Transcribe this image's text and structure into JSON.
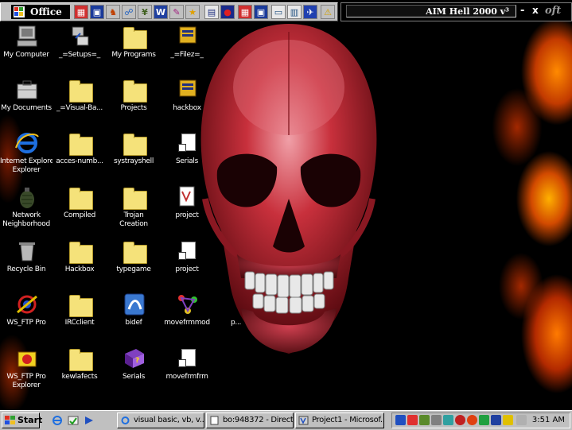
{
  "office_bar": {
    "title": "Office",
    "icons": [
      "office-app-icon-1",
      "office-app-icon-2",
      "office-app-icon-3",
      "office-app-icon-4",
      "office-app-icon-5",
      "office-app-icon-6",
      "office-app-icon-7",
      "office-app-icon-8",
      "office-app-icon-9",
      "office-app-icon-10",
      "office-app-icon-11",
      "office-app-icon-12",
      "office-app-icon-13",
      "office-app-icon-14",
      "office-app-icon-15",
      "office-app-icon-16"
    ]
  },
  "aim_bar": {
    "title": "AIM Hell 2000 v³",
    "minimize": "-",
    "close": "x",
    "brand": "oft"
  },
  "desktop_icons": [
    {
      "label": "My Computer",
      "icon": "computer-icon"
    },
    {
      "label": "My Documents",
      "icon": "briefcase-icon"
    },
    {
      "label": "Internet Explorer",
      "icon": "internet-explorer-icon",
      "label2": "Explorer"
    },
    {
      "label": "Network",
      "label2": "Neighborhood",
      "icon": "grenade-icon"
    },
    {
      "label": "Recycle Bin",
      "icon": "recycle-bin-icon"
    },
    {
      "label": "WS_FTP Pro",
      "icon": "ws-ftp-icon"
    },
    {
      "label": "WS_FTP Pro",
      "label2": "Explorer",
      "icon": "ws-ftp-explorer-icon"
    },
    {
      "label": "_=Setups=_",
      "icon": "setup-icon"
    },
    {
      "label": "_=Visual-Ba...",
      "icon": "folder-icon"
    },
    {
      "label": "acces-numb...",
      "icon": "folder-icon"
    },
    {
      "label": "Compiled",
      "icon": "folder-icon"
    },
    {
      "label": "Hackbox",
      "icon": "folder-icon"
    },
    {
      "label": "IRCclient",
      "icon": "folder-icon"
    },
    {
      "label": "kewlafects",
      "icon": "folder-icon"
    },
    {
      "label": "My Programs",
      "icon": "folder-icon"
    },
    {
      "label": "Projects",
      "icon": "folder-icon"
    },
    {
      "label": "systrayshell",
      "icon": "folder-icon"
    },
    {
      "label": "Trojan",
      "label2": "Creation",
      "icon": "folder-icon"
    },
    {
      "label": "typegame",
      "icon": "folder-icon"
    },
    {
      "label": "bidef",
      "icon": "bidef-icon"
    },
    {
      "label": "Serials",
      "icon": "help-book-icon"
    },
    {
      "label": "_=Filez=_",
      "icon": "filez-icon"
    },
    {
      "label": "hackbox",
      "icon": "hackbox-icon"
    },
    {
      "label": "Serials",
      "icon": "shortcut-doc-icon"
    },
    {
      "label": "project",
      "icon": "project-icon"
    },
    {
      "label": "project",
      "icon": "shortcut-doc-icon"
    },
    {
      "label": "movefrmmod",
      "icon": "molecule-icon"
    },
    {
      "label": "movefrmfrm",
      "icon": "shortcut-doc-icon"
    },
    {
      "label": "p...",
      "icon": "hidden-icon"
    }
  ],
  "taskbar": {
    "start_label": "Start",
    "tasks": [
      {
        "label": "visual basic, vb, v...",
        "icon": "ie-task-icon"
      },
      {
        "label": "bo:948372 - Direct...",
        "icon": "doc-task-icon"
      },
      {
        "label": "Project1 - Microsof...",
        "icon": "vb-task-icon"
      }
    ],
    "clock": "3:51 AM"
  },
  "colors": {
    "taskbar": "#c0c0c0",
    "desktop": "#000000",
    "fire": "#ff8a00",
    "skull": "#b8202a"
  }
}
